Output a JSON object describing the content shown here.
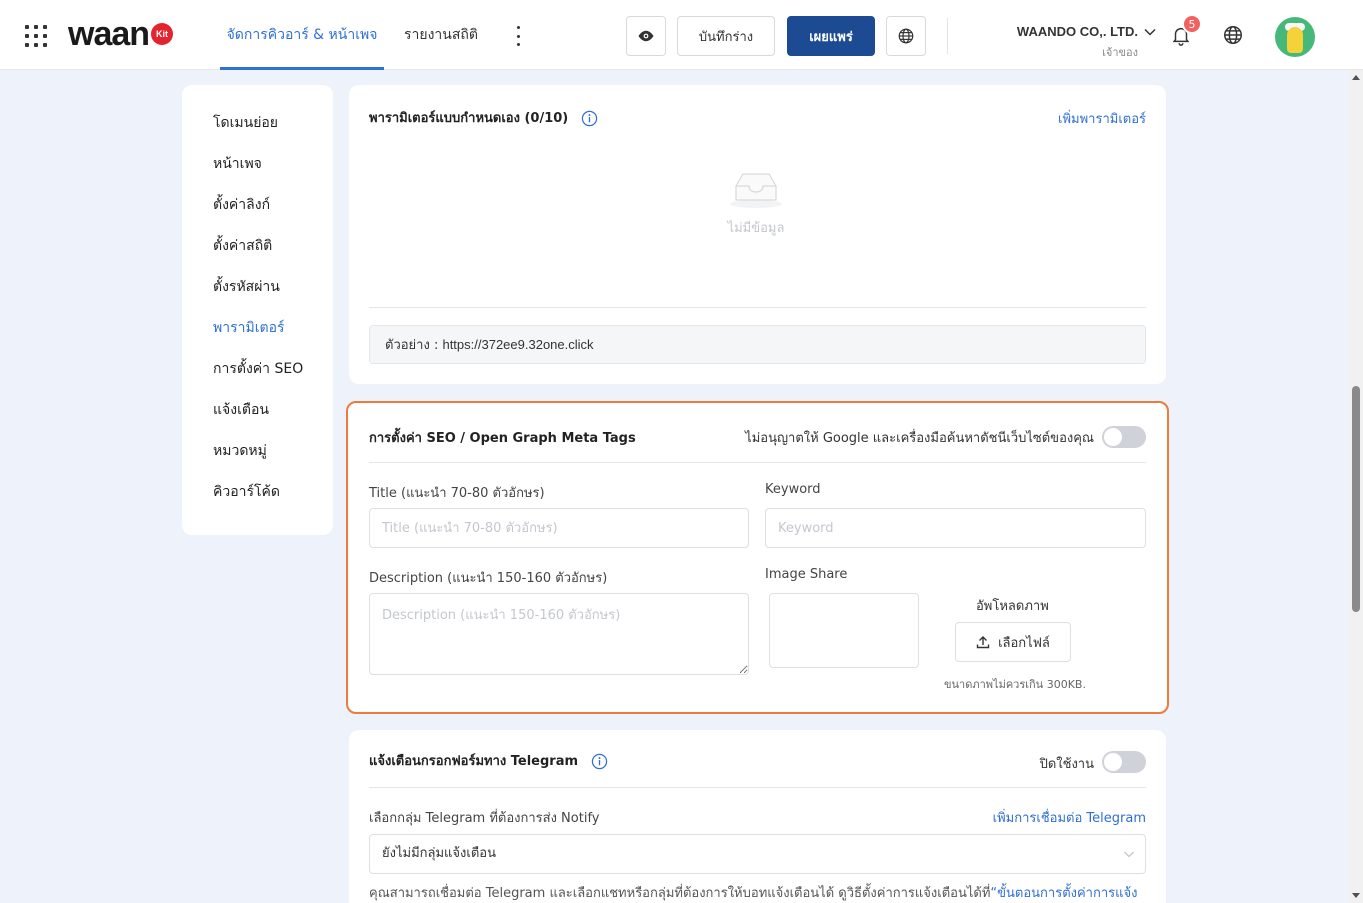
{
  "header": {
    "logo_text": "waan",
    "logo_badge": "Kit",
    "tabs": [
      {
        "label": "จัดการคิวอาร์ & หน้าเพจ",
        "active": true
      },
      {
        "label": "รายงานสถิติ",
        "active": false
      }
    ],
    "save_draft_label": "บันทึกร่าง",
    "publish_label": "เผยแพร่",
    "company_name": "WAANDO CO,. LTD.",
    "company_role": "เจ้าของ",
    "notification_count": "5"
  },
  "sidebar": {
    "items": [
      {
        "label": "โดเมนย่อย"
      },
      {
        "label": "หน้าเพจ"
      },
      {
        "label": "ตั้งค่าลิงก์"
      },
      {
        "label": "ตั้งค่าสถิติ"
      },
      {
        "label": "ตั้งรหัสผ่าน"
      },
      {
        "label": "พารามิเตอร์",
        "active": true
      },
      {
        "label": "การตั้งค่า SEO"
      },
      {
        "label": "แจ้งเตือน"
      },
      {
        "label": "หมวดหมู่"
      },
      {
        "label": "คิวอาร์โค้ด"
      }
    ]
  },
  "params": {
    "title": "พารามิเตอร์แบบกำหนดเอง (0/10)",
    "add_link": "เพิ่มพารามิเตอร์",
    "empty_text": "ไม่มีข้อมูล",
    "example_label": "ตัวอย่าง :",
    "example_url": "https://372ee9.32one.click"
  },
  "seo": {
    "title": "การตั้งค่า SEO / Open Graph Meta Tags",
    "noindex_label": "ไม่อนุญาตให้ Google และเครื่องมือค้นหาดัชนีเว็บไซต์ของคุณ",
    "title_label": "Title (แนะนำ 70-80 ตัวอักษร)",
    "title_placeholder": "Title (แนะนำ 70-80 ตัวอักษร)",
    "keyword_label": "Keyword",
    "keyword_placeholder": "Keyword",
    "description_label": "Description (แนะนำ 150-160 ตัวอักษร)",
    "description_placeholder": "Description (แนะนำ 150-160 ตัวอักษร)",
    "image_share_label": "Image Share",
    "upload_label": "อัพโหลดภาพ",
    "choose_file_label": "เลือกไฟล์",
    "upload_note": "ขนาดภาพไม่ควรเกิน 300KB."
  },
  "telegram": {
    "title": "แจ้งเตือนกรอกฟอร์มทาง Telegram",
    "status_label": "ปิดใช้งาน",
    "group_label": "เลือกกลุ่ม Telegram ที่ต้องการส่ง Notify",
    "add_connection_link": "เพิ่มการเชื่อมต่อ Telegram",
    "select_value": "ยังไม่มีกลุ่มแจ้งเตือน",
    "helper_text": "คุณสามารถเชื่อมต่อ Telegram และเลือกแชทหรือกลุ่มที่ต้องการให้บอทแจ้งเตือนได้ ดูวิธีตั้งค่าการแจ้งเตือนได้ที่",
    "helper_link": "“ขั้นตอนการตั้งค่าการแจ้ง"
  },
  "colors": {
    "accent": "#2f6fd6",
    "primary_button": "#1d4b93",
    "highlight_border": "#ef7a3c",
    "badge": "#f26060"
  }
}
